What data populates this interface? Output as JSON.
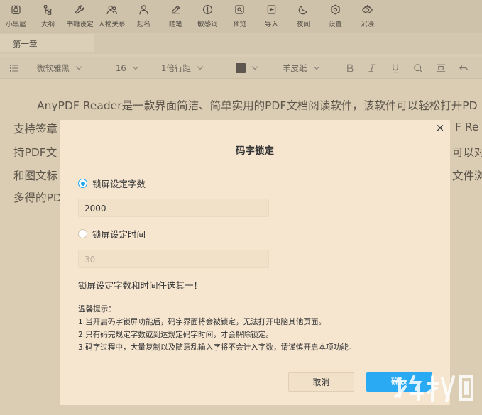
{
  "toolbar": {
    "items": [
      {
        "label": "小黑屋",
        "icon": "lock-icon"
      },
      {
        "label": "大纲",
        "icon": "outline-icon"
      },
      {
        "label": "书籍设定",
        "icon": "wrench-icon"
      },
      {
        "label": "人物关系",
        "icon": "people-icon"
      },
      {
        "label": "起名",
        "icon": "person-icon"
      },
      {
        "label": "随笔",
        "icon": "pencil-icon"
      },
      {
        "label": "敏感词",
        "icon": "alert-icon"
      },
      {
        "label": "预览",
        "icon": "preview-icon"
      },
      {
        "label": "导入",
        "icon": "import-icon"
      },
      {
        "label": "夜间",
        "icon": "moon-icon"
      },
      {
        "label": "设置",
        "icon": "settings-icon"
      },
      {
        "label": "沉浸",
        "icon": "eye-icon"
      }
    ]
  },
  "chapter_tab": "第一章",
  "format": {
    "font": "微软雅黑",
    "size": "16",
    "line_spacing": "1倍行距",
    "color": "#5d5750",
    "paper": "羊皮纸"
  },
  "doc": {
    "line1": "AnyPDF Reader是一款界面简洁、简单实用的PDF文档阅读软件，该软件可以轻松打开PD",
    "line2a": "支持签章",
    "line2b": "F Re",
    "line3a": "持PDF文",
    "line3b": "可以对F",
    "line4a": "和图文标",
    "line4b": "文件浏览",
    "line5a": "多得的PD"
  },
  "modal": {
    "title": "码字锁定",
    "close": "×",
    "option_words": "锁屏设定字数",
    "words_value": "2000",
    "option_time": "锁屏设定时间",
    "time_value": "30",
    "choose_one": "锁屏设定字数和时间任选其一！",
    "tips_title": "温馨提示：",
    "tip1": "1.当开启码字锁屏功能后，码字界面将会被锁定，无法打开电脑其他页面。",
    "tip2": "2.只有码完规定字数或到达规定码字时间，才会解除锁定。",
    "tip3": "3.码字过程中，大量复制以及随意乱输入字将不会计入字数，请谨慎开启本项功能。",
    "cancel": "取消",
    "confirm": "确认"
  },
  "accent_color": "#29aaf2"
}
